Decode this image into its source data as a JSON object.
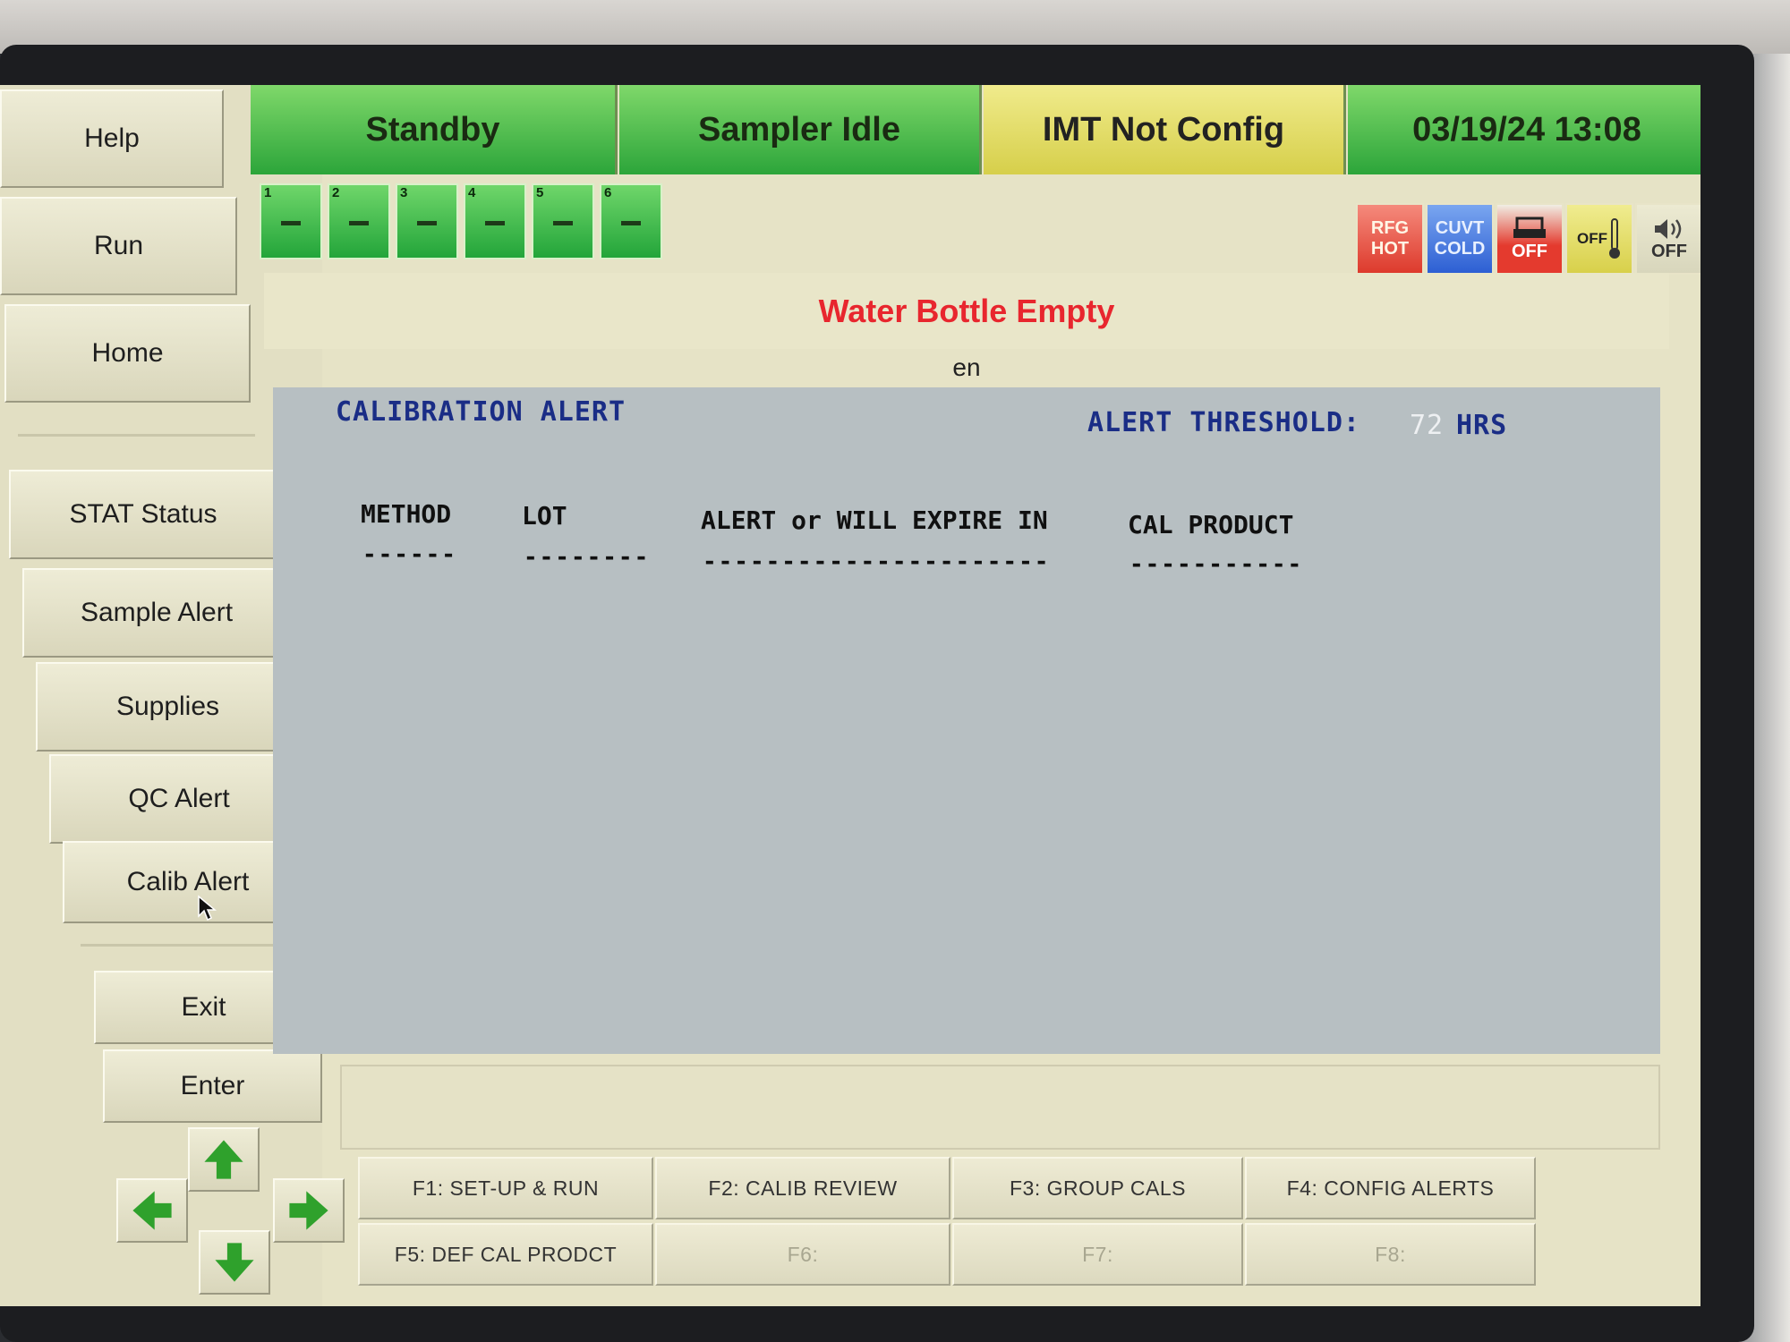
{
  "sidebar": {
    "items": [
      {
        "label": "Help"
      },
      {
        "label": "Run"
      },
      {
        "label": "Home"
      },
      {
        "label": "STAT Status"
      },
      {
        "label": "Sample Alert"
      },
      {
        "label": "Supplies"
      },
      {
        "label": "QC Alert"
      },
      {
        "label": "Calib Alert"
      },
      {
        "label": "Exit"
      },
      {
        "label": "Enter"
      }
    ]
  },
  "status": {
    "system": "Standby",
    "sampler": "Sampler Idle",
    "imt": "IMT Not Config",
    "datetime": "03/19/24 13:08"
  },
  "slots": [
    "1",
    "2",
    "3",
    "4",
    "5",
    "6"
  ],
  "indicators": {
    "rfg": {
      "line1": "RFG",
      "line2": "HOT"
    },
    "cuvt": {
      "line1": "CUVT",
      "line2": "COLD"
    },
    "printer": {
      "state": "OFF"
    },
    "thermo": {
      "state": "OFF"
    },
    "sound": {
      "state": "OFF"
    }
  },
  "message": "Water Bottle Empty",
  "language": "en",
  "calibration": {
    "title": "CALIBRATION ALERT",
    "threshold_label": "ALERT THRESHOLD:",
    "threshold_value": "72",
    "threshold_unit": "HRS",
    "columns": [
      "METHOD",
      "LOT",
      "ALERT or WILL EXPIRE IN",
      "CAL PRODUCT"
    ],
    "underlines": [
      "------",
      "--------",
      "----------------------",
      "-----------"
    ]
  },
  "function_keys": [
    {
      "label": "F1: SET-UP & RUN"
    },
    {
      "label": "F2: CALIB REVIEW"
    },
    {
      "label": "F3: GROUP CALS"
    },
    {
      "label": "F4: CONFIG ALERTS"
    },
    {
      "label": "F5: DEF CAL PRODCT"
    },
    {
      "label": "F6:"
    },
    {
      "label": "F7:"
    },
    {
      "label": "F8:"
    }
  ],
  "colors": {
    "status_green": "#2ca53a",
    "status_yellow": "#d6cf4a",
    "alert_red": "#e8262e",
    "heading_blue": "#1a2d86",
    "panel_gray": "#b7bfc2"
  }
}
